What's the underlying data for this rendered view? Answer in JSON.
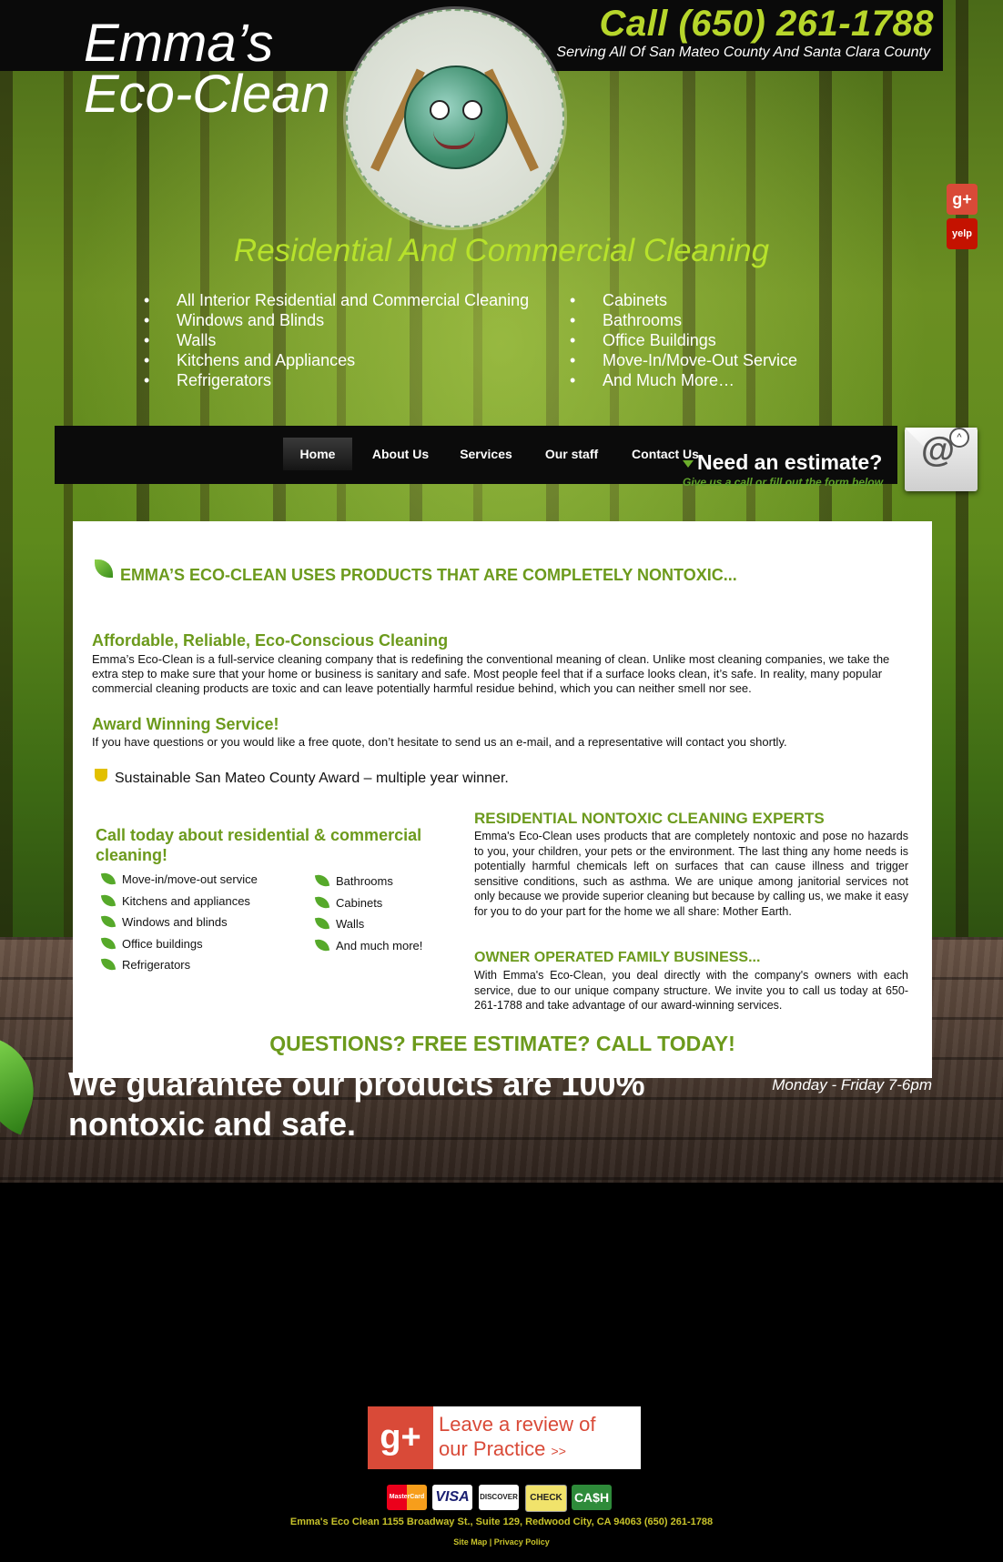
{
  "header": {
    "logo_line1": "Emma’s",
    "logo_line2": "Eco-Clean",
    "phone": "Call (650) 261-1788",
    "serving": "Serving All Of San Mateo County And Santa Clara County"
  },
  "social": {
    "gplus": "g+",
    "yelp": "yelp"
  },
  "hero": {
    "tagline": "Residential And Commercial Cleaning",
    "services_left": [
      "All Interior Residential and Commercial Cleaning",
      "Windows and Blinds",
      "Walls",
      "Kitchens and Appliances",
      "Refrigerators"
    ],
    "services_right": [
      "Cabinets",
      "Bathrooms",
      "Office Buildings",
      "Move-In/Move-Out Service",
      "And Much More…"
    ]
  },
  "nav": {
    "items": [
      "Home",
      "About Us",
      "Services",
      "Our staff",
      "Contact Us"
    ]
  },
  "estimate": {
    "title": "Need an estimate?",
    "subtitle": "Give us a call or fill out the form below"
  },
  "content": {
    "main_heading": "EMMA’S ECO-CLEAN USES PRODUCTS THAT ARE COMPLETELY NONTOXIC...",
    "affordable_heading": "Affordable, Reliable, Eco-Conscious Cleaning",
    "affordable_text": "Emma’s Eco-Clean is a full-service cleaning company that is redefining the conventional meaning of clean. Unlike most cleaning companies, we take the extra step to make sure that your home or business is sanitary and safe. Most people feel that if a surface looks clean, it’s safe. In reality, many popular commercial cleaning products are toxic and can leave potentially harmful residue behind, which you can neither smell nor see.",
    "award_heading": "Award Winning Service!",
    "award_text": "If you have questions or you would like a free quote, don’t hesitate to send us an e-mail, and a representative will contact you shortly.",
    "award_line": "Sustainable San Mateo County Award – multiple year winner.",
    "call_heading": "Call today about residential & commercial cleaning!",
    "list_left": [
      "Move-in/move-out service",
      "Kitchens and appliances",
      "Windows and blinds",
      "Office buildings",
      "Refrigerators"
    ],
    "list_right": [
      "Bathrooms",
      "Cabinets",
      "Walls",
      "And much more!"
    ],
    "residential_heading": "RESIDENTIAL NONTOXIC CLEANING EXPERTS",
    "residential_text": "Emma's Eco-Clean uses products that are completely nontoxic and pose no hazards to you, your children, your pets or the environment. The last thing any home needs is potentially harmful chemicals left on surfaces that can cause illness and trigger sensitive conditions, such as asthma. We are unique among janitorial services not only because we provide superior cleaning but because by calling us, we make it easy for you to do your part for the home we all share: Mother Earth.",
    "owner_heading": "OWNER OPERATED FAMILY BUSINESS...",
    "owner_text": "With Emma's Eco-Clean, you deal directly with the company's owners with each service, due to our unique company structure. We invite you to call us today at 650-261-1788 and take advantage of our award-winning services.",
    "questions": "QUESTIONS? FREE ESTIMATE? CALL TODAY!"
  },
  "guarantee": {
    "text": "We guarantee our products are 100% nontoxic and safe.",
    "hours": "Monday - Friday 7-6pm"
  },
  "footer": {
    "review_g": "g+",
    "review_line1": "Leave a review of",
    "review_line2": "our Practice",
    "cards": [
      "MasterCard",
      "VISA",
      "DISCOVER",
      "CHECK",
      "CA$H"
    ],
    "address": "Emma's Eco Clean 1155 Broadway St., Suite 129, Redwood City, CA 94063 (650) 261-1788",
    "site_map": "Site Map",
    "privacy": "Privacy Policy"
  },
  "colors": {
    "accent": "#b7d62b",
    "green": "#6c9a1c",
    "review_red": "#d94a38"
  }
}
